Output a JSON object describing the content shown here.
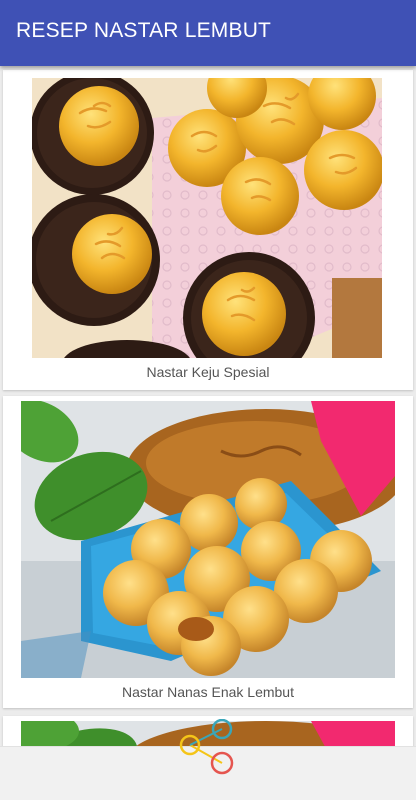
{
  "app": {
    "title": "RESEP NASTAR LEMBUT",
    "accent_color": "#3f51b5"
  },
  "recipes": [
    {
      "title": "Nastar Keju Spesial",
      "image_icon": "cheese-nastar-photo"
    },
    {
      "title": "Nastar Nanas Enak Lembut",
      "image_icon": "pineapple-nastar-photo"
    },
    {
      "title": "",
      "image_icon": "pineapple-nastar-photo"
    }
  ],
  "loading": {
    "icon": "loading-spinner-icon",
    "colors": [
      "#f5c518",
      "#3aa6b9",
      "#e5554f"
    ]
  }
}
